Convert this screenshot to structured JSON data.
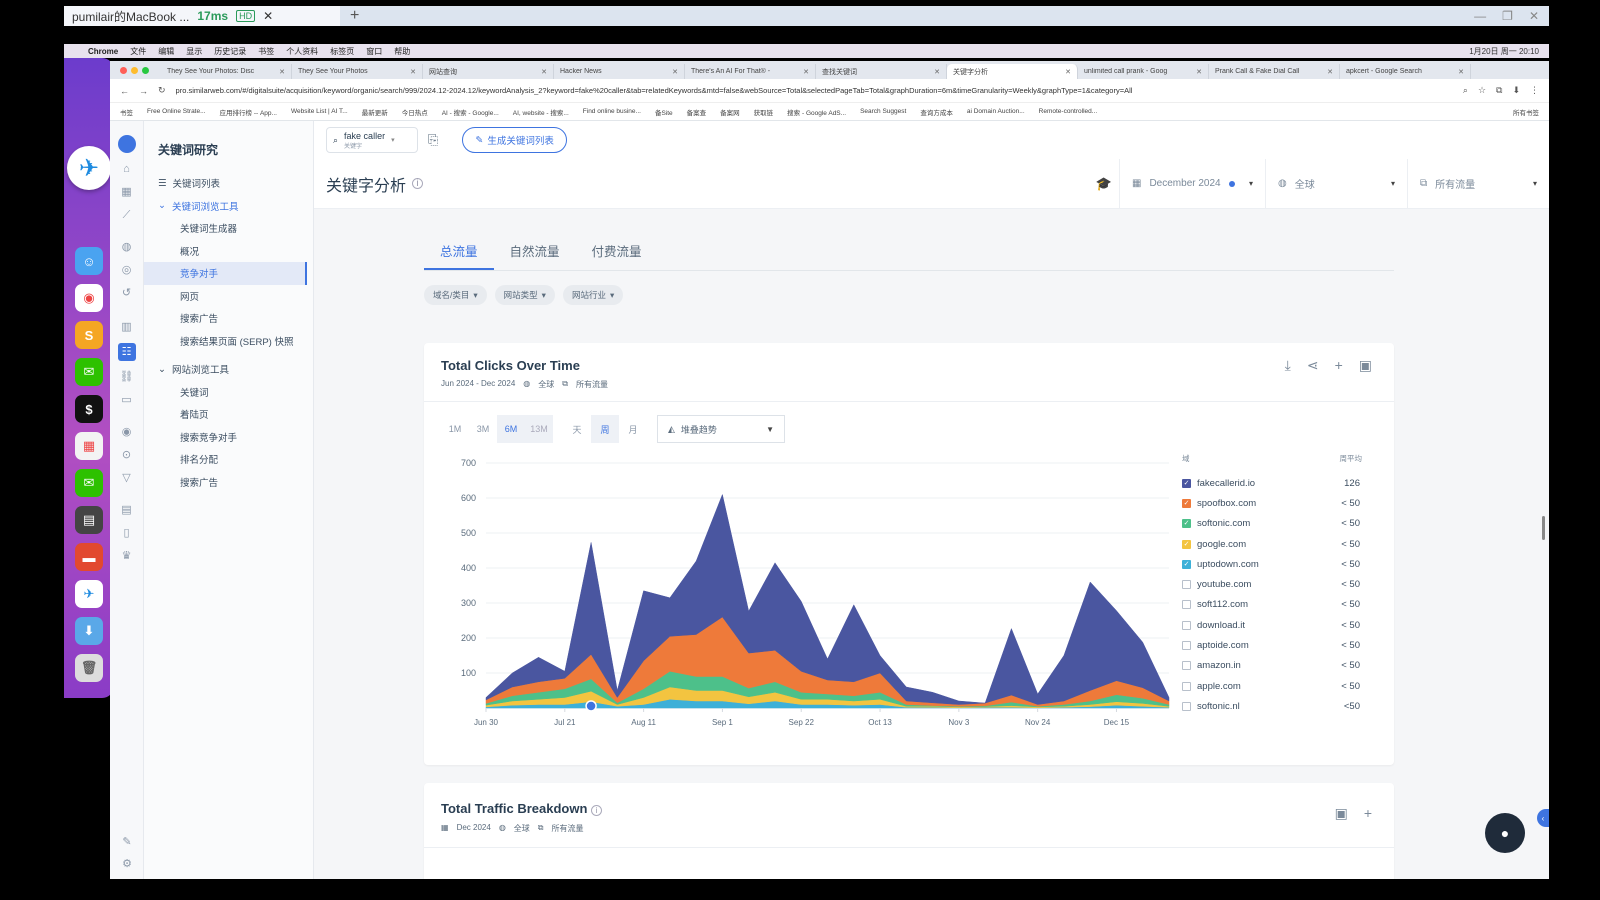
{
  "remote": {
    "title": "pumilair的MacBook ...",
    "latency": "17ms",
    "quality": "HD"
  },
  "mac_menu": {
    "items": [
      "Chrome",
      "文件",
      "编辑",
      "显示",
      "历史记录",
      "书签",
      "个人资料",
      "标签页",
      "窗口",
      "帮助"
    ],
    "clock": "1月20日 周一 20:10"
  },
  "browser": {
    "tabs": [
      {
        "label": "They See Your Photos: Disc",
        "active": false
      },
      {
        "label": "They See Your Photos",
        "active": false
      },
      {
        "label": "网站查询",
        "active": false
      },
      {
        "label": "Hacker News",
        "active": false
      },
      {
        "label": "There's An AI For That® - ",
        "active": false
      },
      {
        "label": "查找关键词",
        "active": false
      },
      {
        "label": "关键字分析",
        "active": true
      },
      {
        "label": "unlimited call prank - Goog",
        "active": false
      },
      {
        "label": "Prank Call & Fake Dial Call",
        "active": false
      },
      {
        "label": "apkcert - Google Search",
        "active": false
      }
    ],
    "url": "pro.similarweb.com/#/digitalsuite/acquisition/keyword/organic/search/999/2024.12-2024.12/keywordAnalysis_2?keyword=fake%20caller&tab=relatedKeywords&mtd=false&webSource=Total&selectedPageTab=Total&graphDuration=6m&timeGranularity=Weekly&graphType=1&category=All",
    "bookmarks": [
      "书签",
      "Free Online Strate...",
      "应用排行榜 -- App...",
      "Website List | AI T...",
      "最新更新",
      "今日热点",
      "AI - 搜索 - Google...",
      "AI, website - 搜索...",
      "Find online busine...",
      "备Site",
      "备案查",
      "备案网",
      "获取链",
      "搜索 - Google AdS...",
      "Search Suggest",
      "查询方成本",
      "ai Domain Auction...",
      "Remote-controlled...",
      "所有书签"
    ]
  },
  "sidebar": {
    "title": "关键词研究",
    "items": [
      {
        "label": "关键词列表",
        "level": 1,
        "icon": "list-icon"
      },
      {
        "label": "关键词浏览工具",
        "level": 1,
        "expanded": true
      },
      {
        "label": "关键词生成器",
        "level": 2
      },
      {
        "label": "概况",
        "level": 2
      },
      {
        "label": "竞争对手",
        "level": 2,
        "active": true
      },
      {
        "label": "网页",
        "level": 2
      },
      {
        "label": "搜索广告",
        "level": 2
      },
      {
        "label": "搜索结果页面 (SERP) 快照",
        "level": 2
      },
      {
        "label": "网站浏览工具",
        "level": 1,
        "expanded": true
      },
      {
        "label": "关键词",
        "level": 2
      },
      {
        "label": "着陆页",
        "level": 2
      },
      {
        "label": "搜索竞争对手",
        "level": 2
      },
      {
        "label": "排名分配",
        "level": 2
      },
      {
        "label": "搜索广告",
        "level": 2
      }
    ]
  },
  "topbar": {
    "search_value": "fake caller",
    "search_sub": "关键字",
    "generate_label": "生成关键词列表"
  },
  "page": {
    "title": "关键字分析",
    "date_filter": "December 2024",
    "region_filter": "全球",
    "traffic_filter": "所有流量",
    "traffic_tabs": [
      "总流量",
      "自然流量",
      "付费流量"
    ],
    "chips": [
      "域名/类目",
      "网站类型",
      "网站行业"
    ]
  },
  "chart_card": {
    "title": "Total Clicks Over Time",
    "date_range": "Jun 2024 - Dec 2024",
    "region": "全球",
    "traffic": "所有流量",
    "durations": [
      "1M",
      "3M",
      "6M",
      "13M"
    ],
    "selected_duration": "6M",
    "granularity": [
      "天",
      "周",
      "月"
    ],
    "selected_granularity": "周",
    "chart_type": "堆叠趋势",
    "legend_header_domain": "域",
    "legend_header_value": "周平均"
  },
  "chart_data": {
    "type": "area",
    "stacked": true,
    "ylim": [
      0,
      700
    ],
    "yticks": [
      100,
      200,
      300,
      400,
      500,
      600,
      700
    ],
    "xticks": [
      {
        "i": 0,
        "label": "Jun 30"
      },
      {
        "i": 3,
        "label": "Jul 21"
      },
      {
        "i": 6,
        "label": "Aug 11"
      },
      {
        "i": 9,
        "label": "Sep 1"
      },
      {
        "i": 12,
        "label": "Sep 22"
      },
      {
        "i": 15,
        "label": "Oct 13"
      },
      {
        "i": 18,
        "label": "Nov 3"
      },
      {
        "i": 21,
        "label": "Nov 24"
      },
      {
        "i": 24,
        "label": "Dec 15"
      }
    ],
    "x_count": 27,
    "series": [
      {
        "name": "softonic.com",
        "color": "#3db0d8",
        "values": [
          3,
          8,
          10,
          10,
          18,
          5,
          10,
          25,
          20,
          20,
          12,
          20,
          10,
          10,
          8,
          10,
          2,
          2,
          1,
          2,
          2,
          1,
          2,
          4,
          8,
          5,
          2
        ]
      },
      {
        "name": "google.com",
        "color": "#f3c440",
        "values": [
          5,
          12,
          15,
          20,
          30,
          5,
          20,
          35,
          30,
          30,
          20,
          25,
          15,
          15,
          12,
          15,
          3,
          3,
          2,
          2,
          5,
          2,
          3,
          6,
          10,
          8,
          3
        ]
      },
      {
        "name": "uptodown.com",
        "color": "#4dc08a",
        "values": [
          5,
          15,
          20,
          25,
          35,
          5,
          25,
          45,
          40,
          40,
          25,
          30,
          20,
          15,
          15,
          20,
          5,
          2,
          2,
          2,
          10,
          2,
          5,
          10,
          20,
          15,
          5
        ]
      },
      {
        "name": "spoofbox.com",
        "color": "#ee7a3a",
        "values": [
          10,
          25,
          30,
          30,
          70,
          15,
          80,
          100,
          120,
          170,
          100,
          90,
          60,
          40,
          40,
          55,
          10,
          8,
          5,
          8,
          20,
          5,
          10,
          30,
          40,
          30,
          10
        ]
      },
      {
        "name": "fakecallerid.io",
        "color": "#4a56a0",
        "values": [
          7,
          40,
          70,
          20,
          320,
          20,
          200,
          110,
          210,
          350,
          120,
          250,
          200,
          60,
          220,
          50,
          40,
          30,
          10,
          0,
          190,
          30,
          130,
          310,
          200,
          130,
          10
        ]
      }
    ],
    "legend": [
      {
        "domain": "fakecallerid.io",
        "value": "126",
        "checked": true,
        "color": "#4a56a0"
      },
      {
        "domain": "spoofbox.com",
        "value": "< 50",
        "checked": true,
        "color": "#ee7a3a"
      },
      {
        "domain": "softonic.com",
        "value": "< 50",
        "checked": true,
        "color": "#4dc08a"
      },
      {
        "domain": "google.com",
        "value": "< 50",
        "checked": true,
        "color": "#f3c440"
      },
      {
        "domain": "uptodown.com",
        "value": "< 50",
        "checked": true,
        "color": "#3db0d8"
      },
      {
        "domain": "youtube.com",
        "value": "< 50",
        "checked": false
      },
      {
        "domain": "soft112.com",
        "value": "< 50",
        "checked": false
      },
      {
        "domain": "download.it",
        "value": "< 50",
        "checked": false
      },
      {
        "domain": "aptoide.com",
        "value": "< 50",
        "checked": false
      },
      {
        "domain": "amazon.in",
        "value": "< 50",
        "checked": false
      },
      {
        "domain": "apple.com",
        "value": "< 50",
        "checked": false
      },
      {
        "domain": "softonic.nl",
        "value": "<50",
        "checked": false
      }
    ]
  },
  "breakdown_card": {
    "title": "Total Traffic Breakdown",
    "date": "Dec 2024",
    "region": "全球",
    "traffic": "所有流量"
  }
}
